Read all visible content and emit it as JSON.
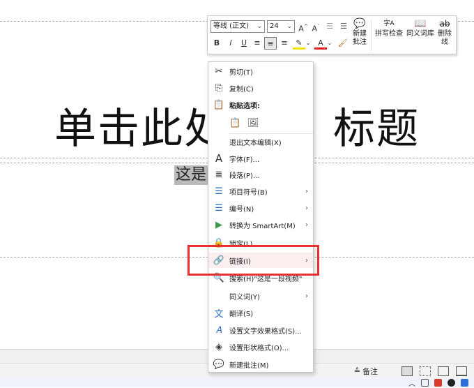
{
  "slide": {
    "title": "单击此处添加标题",
    "title_visible_left": "单击此处",
    "title_visible_right": "标题",
    "subtitle": "这是"
  },
  "minibar": {
    "font": "等线 (正文)",
    "size": "24",
    "new_comment": "新建批注",
    "spell_check": "拼写检查",
    "thesaurus": "同义词库",
    "strike": "删除线",
    "spell_icon_text": "字A"
  },
  "menu": {
    "cut": "剪切(T)",
    "copy": "复制(C)",
    "paste_options": "粘贴选项:",
    "exit_edit": "退出文本编辑(X)",
    "font": "字体(F)...",
    "paragraph": "段落(P)...",
    "bullets": "项目符号(B)",
    "numbering": "编号(N)",
    "smartart": "转换为 SmartArt(M)",
    "lock": "锁定(L)",
    "link": "链接(I)",
    "search": "搜索(H)\"这是一段视频\"",
    "synonyms": "同义词(Y)",
    "translate": "翻译(S)",
    "text_effects": "设置文字效果格式(S)...",
    "shape_format": "设置形状格式(O)...",
    "new_comment": "新建批注(M)"
  },
  "statusbar": {
    "notes": "备注"
  },
  "colors": {
    "highlight_red": "#e8302e",
    "menu_hover": "#fbeeee",
    "subtitle_selection": "#b9b9b9"
  }
}
